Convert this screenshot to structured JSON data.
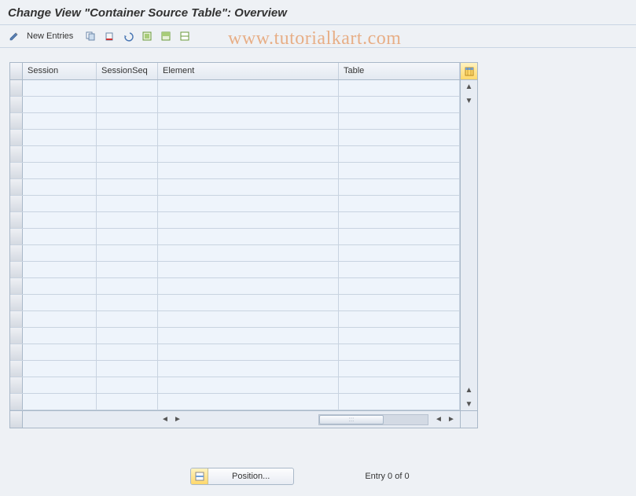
{
  "title": "Change View \"Container Source Table\": Overview",
  "watermark": "www.tutorialkart.com",
  "toolbar": {
    "new_entries_label": "New Entries"
  },
  "grid": {
    "columns": {
      "session": "Session",
      "sessionSeq": "SessionSeq",
      "element": "Element",
      "table": "Table"
    },
    "row_count": 20
  },
  "position_button_label": "Position...",
  "entry_status": "Entry 0 of 0"
}
